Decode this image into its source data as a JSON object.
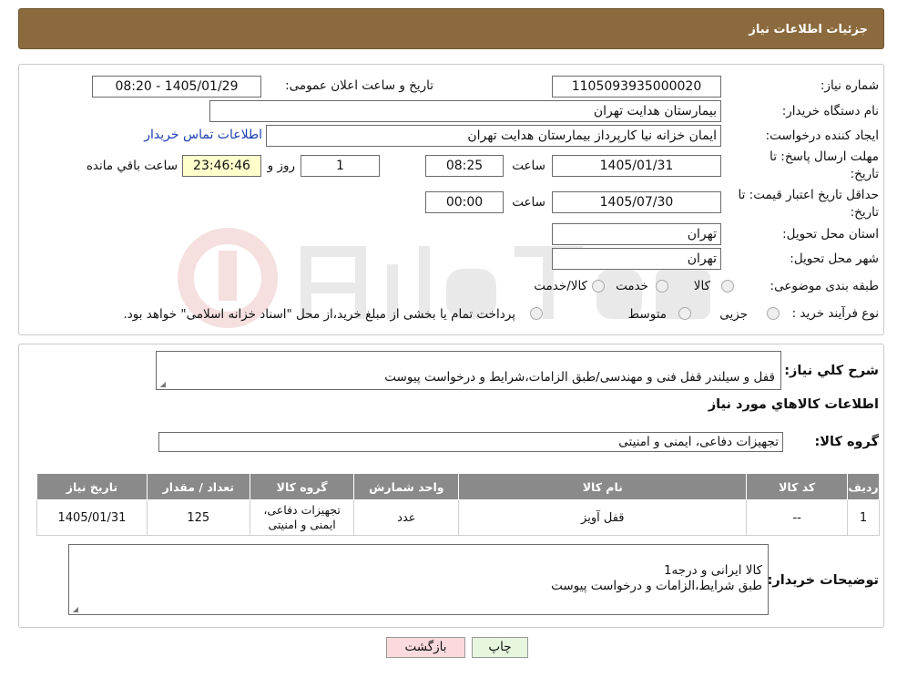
{
  "header": {
    "title": "جزئیات اطلاعات نیاز"
  },
  "form": {
    "need_number_label": "شماره نیاز:",
    "need_number": "1105093935000020",
    "announce_label": "تاریخ و ساعت اعلان عمومی:",
    "announce_value": "1405/01/29 - 08:20",
    "buyer_org_label": "نام دستگاه خریدار:",
    "buyer_org": "بیمارستان هدایت تهران",
    "requester_label": "ایجاد کننده درخواست:",
    "requester": "ایمان خزانه نیا کارپرداز بیمارستان هدایت تهران",
    "contact_link": "اطلاعات تماس خریدار",
    "deadline_label_1": "مهلت ارسال پاسخ: تا",
    "deadline_label_2": "تاریخ:",
    "deadline_date": "1405/01/31",
    "time_label": "ساعت",
    "deadline_time": "08:25",
    "day_count": "1",
    "day_label": "روز و",
    "remaining": "23:46:46",
    "remaining_label": "ساعت باقي مانده",
    "validity_label_1": "حداقل تاریخ اعتبار قیمت: تا",
    "validity_label_2": "تاریخ:",
    "validity_date": "1405/07/30",
    "validity_time": "00:00",
    "province_label": "استان محل تحویل:",
    "province": "تهران",
    "city_label": "شهر محل تحویل:",
    "city": "تهران",
    "category_label": "طبقه بندی موضوعی:",
    "category_options": [
      "کالا",
      "خدمت",
      "کالا/خدمت"
    ],
    "purchase_type_label": "نوع فرآیند خرید :",
    "purchase_options": [
      "جزیی",
      "متوسط"
    ],
    "purchase_note": "پرداخت تمام یا بخشی از مبلغ خرید،از محل \"اسناد خزانه اسلامی\" خواهد بود."
  },
  "details": {
    "summary_label": "شرح کلي نياز:",
    "summary": "قفل و سیلندر قفل فنی و مهندسی/طبق الزامات،شرایط و درخواست پیوست",
    "goods_info_title": "اطلاعات کالاهاي مورد نياز",
    "goods_group_label": "گروه کالا:",
    "goods_group": "تجهیزات دفاعی، ایمنی و امنیتی",
    "buyer_notes_label": "توضیحات خریدار:",
    "buyer_notes": "کالا ایرانی و درجه1\nطبق شرایط،الزامات و درخواست پیوست"
  },
  "table": {
    "headers": [
      "ردیف",
      "کد کالا",
      "نام کالا",
      "واحد شمارش",
      "گروه کالا",
      "تعداد / مقدار",
      "تاریخ نیاز"
    ],
    "rows": [
      [
        "1",
        "--",
        "قفل آویز",
        "عدد",
        "تجهیزات دفاعی، ایمنی و امنیتی",
        "125",
        "1405/01/31"
      ]
    ]
  },
  "buttons": {
    "print": "چاپ",
    "back": "بازگشت"
  },
  "colors": {
    "header_bg": "#8b6b3d",
    "table_header_bg": "#8a8a8a",
    "back_btn_bg": "#fadadd",
    "print_btn_bg": "#e6f7dd"
  }
}
